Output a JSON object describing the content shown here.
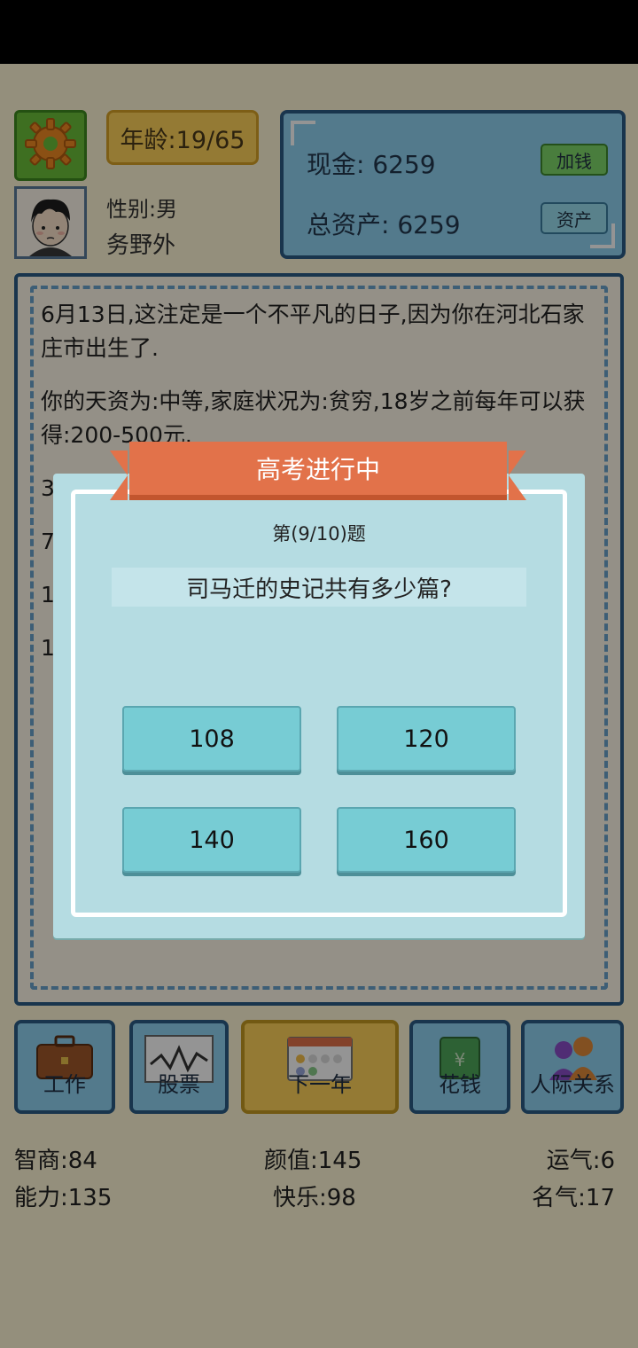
{
  "header": {
    "age_label": "年龄:19/65",
    "gender": "性别:男",
    "job": "务野外"
  },
  "money": {
    "cash": "现金: 6259",
    "total_assets": "总资产: 6259",
    "add_money_label": "加钱",
    "assets_label": "资产"
  },
  "log": {
    "entries": [
      "6月13日,这注定是一个不平凡的日子,因为你在河北石家庄市出生了.",
      "你的天资为:中等,家庭状况为:贫穷,18岁之前每年可以获得:200-500元.",
      "3",
      "7",
      "1",
      "1"
    ]
  },
  "bottom_nav": {
    "work": "工作",
    "stock": "股票",
    "next_year": "下一年",
    "spend": "花钱",
    "social": "人际关系"
  },
  "stats": {
    "iq": "智商:84",
    "looks": "颜值:145",
    "luck": "运气:6",
    "ability": "能力:135",
    "happiness": "快乐:98",
    "fame": "名气:17"
  },
  "exam": {
    "title": "高考进行中",
    "question_number": "第(9/10)题",
    "question": "司马迁的史记共有多少篇?",
    "answers": [
      "108",
      "120",
      "140",
      "160"
    ]
  },
  "colors": {
    "accent_blue": "#2c5c86",
    "panel_blue": "#8fd3f2",
    "ribbon": "#e2724a",
    "answer_button": "#77ccd4"
  }
}
